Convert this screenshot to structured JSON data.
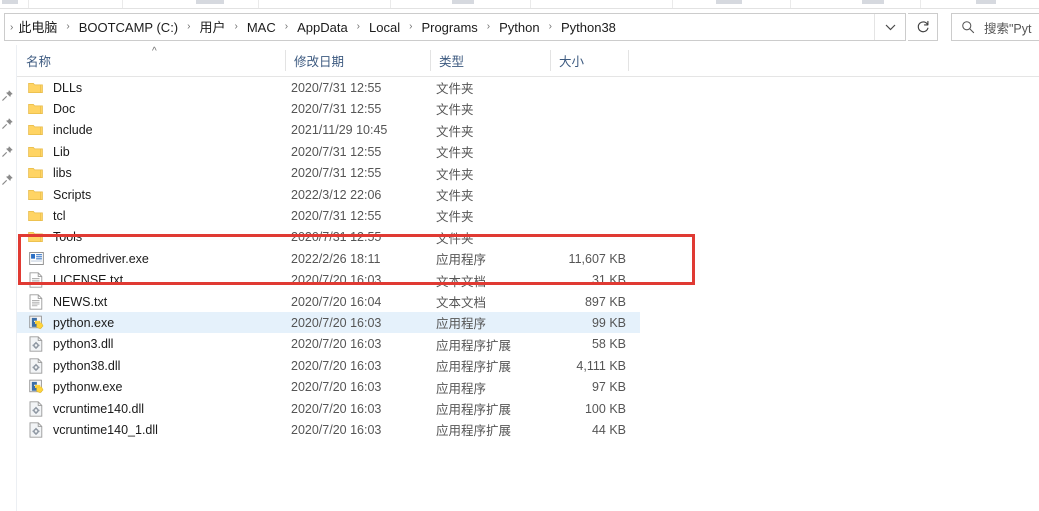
{
  "window": {
    "type": "windows-file-explorer"
  },
  "address_bar": {
    "breadcrumb": [
      "此电脑",
      "BOOTCAMP (C:)",
      "用户",
      "MAC",
      "AppData",
      "Local",
      "Programs",
      "Python",
      "Python38"
    ],
    "separator": "›",
    "dropdown_icon": "chevron-down-icon",
    "refresh_icon": "refresh-icon",
    "refresh_glyph": "↻"
  },
  "search": {
    "icon": "search-icon",
    "placeholder": "搜索\"Pyt"
  },
  "nav_pane": {
    "pin_icon": "pin-icon",
    "pin_count": 4
  },
  "columns": {
    "headers": [
      {
        "label": "名称",
        "name": "column-header-name"
      },
      {
        "label": "修改日期",
        "name": "column-header-date-modified"
      },
      {
        "label": "类型",
        "name": "column-header-type"
      },
      {
        "label": "大小",
        "name": "column-header-size"
      }
    ],
    "sort_indicator": "^",
    "sorted_by": "名称"
  },
  "files": [
    {
      "name": "DLLs",
      "date": "2020/7/31 12:55",
      "type": "文件夹",
      "size": "",
      "icon": "folder-icon",
      "selected": false
    },
    {
      "name": "Doc",
      "date": "2020/7/31 12:55",
      "type": "文件夹",
      "size": "",
      "icon": "folder-icon",
      "selected": false
    },
    {
      "name": "include",
      "date": "2021/11/29 10:45",
      "type": "文件夹",
      "size": "",
      "icon": "folder-icon",
      "selected": false
    },
    {
      "name": "Lib",
      "date": "2020/7/31 12:55",
      "type": "文件夹",
      "size": "",
      "icon": "folder-icon",
      "selected": false
    },
    {
      "name": "libs",
      "date": "2020/7/31 12:55",
      "type": "文件夹",
      "size": "",
      "icon": "folder-icon",
      "selected": false
    },
    {
      "name": "Scripts",
      "date": "2022/3/12 22:06",
      "type": "文件夹",
      "size": "",
      "icon": "folder-icon",
      "selected": false
    },
    {
      "name": "tcl",
      "date": "2020/7/31 12:55",
      "type": "文件夹",
      "size": "",
      "icon": "folder-icon",
      "selected": false
    },
    {
      "name": "Tools",
      "date": "2020/7/31 12:55",
      "type": "文件夹",
      "size": "",
      "icon": "folder-icon",
      "selected": false
    },
    {
      "name": "chromedriver.exe",
      "date": "2022/2/26 18:11",
      "type": "应用程序",
      "size": "11,607 KB",
      "icon": "application-icon",
      "selected": false
    },
    {
      "name": "LICENSE.txt",
      "date": "2020/7/20 16:03",
      "type": "文本文档",
      "size": "31 KB",
      "icon": "text-file-icon",
      "selected": false
    },
    {
      "name": "NEWS.txt",
      "date": "2020/7/20 16:04",
      "type": "文本文档",
      "size": "897 KB",
      "icon": "text-file-icon",
      "selected": false
    },
    {
      "name": "python.exe",
      "date": "2020/7/20 16:03",
      "type": "应用程序",
      "size": "99 KB",
      "icon": "python-exe-icon",
      "selected": true
    },
    {
      "name": "python3.dll",
      "date": "2020/7/20 16:03",
      "type": "应用程序扩展",
      "size": "58 KB",
      "icon": "dll-file-icon",
      "selected": false
    },
    {
      "name": "python38.dll",
      "date": "2020/7/20 16:03",
      "type": "应用程序扩展",
      "size": "4,111 KB",
      "icon": "dll-file-icon",
      "selected": false
    },
    {
      "name": "pythonw.exe",
      "date": "2020/7/20 16:03",
      "type": "应用程序",
      "size": "97 KB",
      "icon": "python-exe-icon",
      "selected": false
    },
    {
      "name": "vcruntime140.dll",
      "date": "2020/7/20 16:03",
      "type": "应用程序扩展",
      "size": "100 KB",
      "icon": "dll-file-icon",
      "selected": false
    },
    {
      "name": "vcruntime140_1.dll",
      "date": "2020/7/20 16:03",
      "type": "应用程序扩展",
      "size": "44 KB",
      "icon": "dll-file-icon",
      "selected": false
    }
  ],
  "annotation": {
    "shape": "rectangle",
    "color": "#e03a33",
    "highlights": [
      "Tools",
      "chromedriver.exe"
    ]
  },
  "colors": {
    "selection": "#e5f1fb",
    "folder": "#ffd464",
    "header_text": "#3d5a80",
    "annotation": "#e03a33"
  }
}
